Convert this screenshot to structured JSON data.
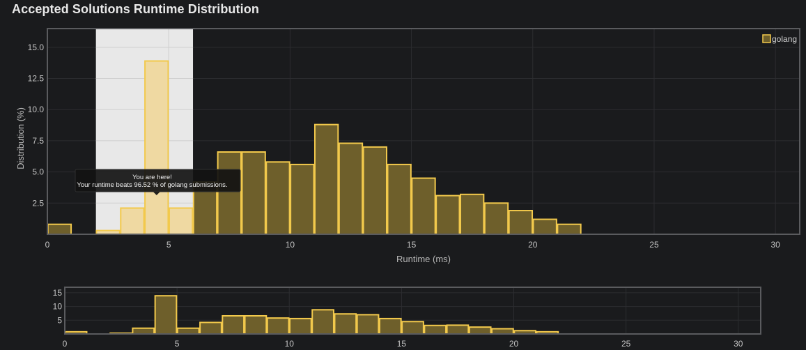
{
  "page": {
    "title": "Accepted Solutions Runtime Distribution"
  },
  "colors": {
    "background": "#1a1b1d",
    "bar_fill": "#6e5f2b",
    "bar_stroke": "#f2c94c",
    "highlight_fill": "#efd9a2",
    "highlight_band": "#e8e8e8",
    "grid": "#2c2d30",
    "frame": "#5a5b5e"
  },
  "chart_data": {
    "type": "bar",
    "x_label": "Runtime (ms)",
    "y_label": "Distribution (%)",
    "x_range": [
      0,
      31
    ],
    "y_range": [
      0,
      16.5
    ],
    "x_ticks": [
      "0",
      "5",
      "10",
      "15",
      "20",
      "25",
      "30"
    ],
    "y_ticks": [
      "2.5",
      "5.0",
      "7.5",
      "10.0",
      "12.5",
      "15.0"
    ],
    "grid": true,
    "legend": {
      "position": "top-right",
      "label": "golang"
    },
    "highlight_range": [
      2,
      6
    ],
    "tooltip": {
      "line1": "You are here!",
      "line2": "Your runtime beats 96.52 % of golang submissions."
    },
    "series": [
      {
        "name": "golang",
        "bins": [
          {
            "x0": 0,
            "x1": 1,
            "value": 0.8
          },
          {
            "x0": 2,
            "x1": 3,
            "value": 0.3
          },
          {
            "x0": 3,
            "x1": 4,
            "value": 2.1
          },
          {
            "x0": 4,
            "x1": 5,
            "value": 13.9
          },
          {
            "x0": 5,
            "x1": 6,
            "value": 2.1
          },
          {
            "x0": 6,
            "x1": 7,
            "value": 4.2
          },
          {
            "x0": 7,
            "x1": 8,
            "value": 6.6
          },
          {
            "x0": 8,
            "x1": 9,
            "value": 6.6
          },
          {
            "x0": 9,
            "x1": 10,
            "value": 5.8
          },
          {
            "x0": 10,
            "x1": 11,
            "value": 5.6
          },
          {
            "x0": 11,
            "x1": 12,
            "value": 8.8
          },
          {
            "x0": 12,
            "x1": 13,
            "value": 7.3
          },
          {
            "x0": 13,
            "x1": 14,
            "value": 7.0
          },
          {
            "x0": 14,
            "x1": 15,
            "value": 5.6
          },
          {
            "x0": 15,
            "x1": 16,
            "value": 4.5
          },
          {
            "x0": 16,
            "x1": 17,
            "value": 3.1
          },
          {
            "x0": 17,
            "x1": 18,
            "value": 3.2
          },
          {
            "x0": 18,
            "x1": 19,
            "value": 2.5
          },
          {
            "x0": 19,
            "x1": 20,
            "value": 1.9
          },
          {
            "x0": 20,
            "x1": 21,
            "value": 1.2
          },
          {
            "x0": 21,
            "x1": 22,
            "value": 0.8
          }
        ]
      }
    ],
    "navigator": {
      "y_ticks": [
        "5",
        "10",
        "15"
      ],
      "x_ticks": [
        "0",
        "5",
        "10",
        "15",
        "20",
        "25",
        "30"
      ]
    }
  }
}
